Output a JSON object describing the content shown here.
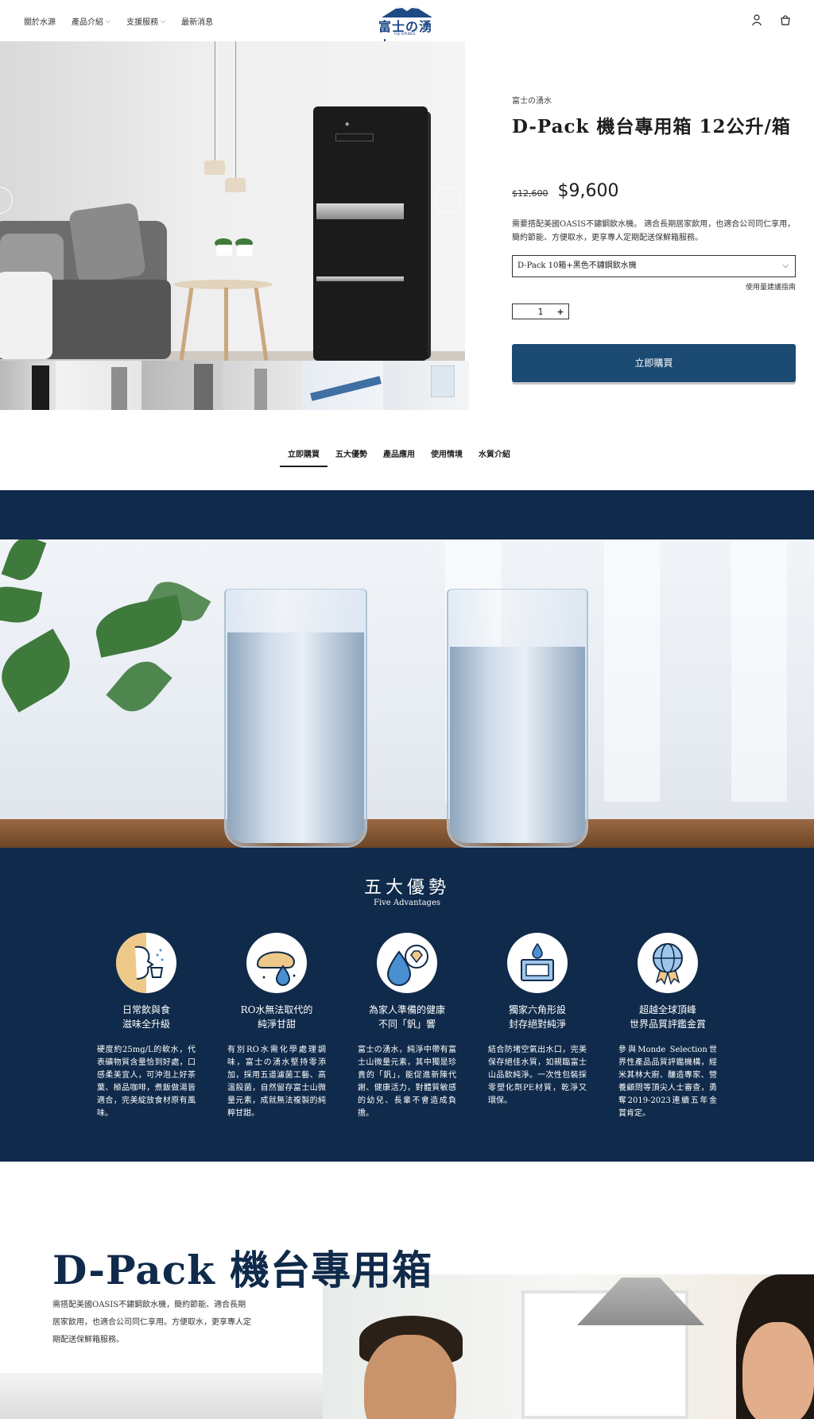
{
  "header": {
    "nav": [
      {
        "label": "關於水源",
        "has_dropdown": false
      },
      {
        "label": "產品介紹",
        "has_dropdown": true
      },
      {
        "label": "支援服務",
        "has_dropdown": true
      },
      {
        "label": "最新消息",
        "has_dropdown": false
      }
    ],
    "logo_text": "富士の湧水",
    "logo_sub": "FUJI SPRINGS",
    "icons": [
      "account-icon",
      "cart-icon"
    ]
  },
  "gallery": {
    "prev_arrow": "‹",
    "next_arrow": "›",
    "thumbnail_count": 6
  },
  "product": {
    "brand": "富士の湧水",
    "title": "D-Pack 機台專用箱 12公升/箱",
    "old_price": "$12,600",
    "price": "$9,600",
    "description": "需要搭配美國OASIS不鏽鋼飲水機。 適合長期居家飲用，也適合公司同仁享用，簡約節能、方便取水，更享專人定期配送保鮮箱服務。",
    "variant_selected": "D-Pack 10箱+黑色不鏽鋼飲水機",
    "guide_link": "使用量建議指南",
    "quantity": "1",
    "buy_label": "立即購買"
  },
  "tabs": [
    {
      "label": "立即購買",
      "active": true
    },
    {
      "label": "五大優勢",
      "active": false
    },
    {
      "label": "產品應用",
      "active": false
    },
    {
      "label": "使用情境",
      "active": false
    },
    {
      "label": "水質介紹",
      "active": false
    }
  ],
  "advantages": {
    "title": "五大優勢",
    "subtitle": "Five Advantages",
    "items": [
      {
        "icon": "drinking-face-icon",
        "heading_1": "日常飲與食",
        "heading_2": "滋味全升級",
        "text": "硬度約25mg/L的軟水，代表礦物質含量恰到好處，口感柔美宜人，可沖泡上好茶葉、極品咖啡，煮飯做湯皆適合，完美綻放食材原有風味。"
      },
      {
        "icon": "bread-drop-icon",
        "heading_1": "RO水無法取代的",
        "heading_2": "純淨甘甜",
        "text": "有別RO水需化學處理調味，富士の湧水堅持零添加，採用五道濾菌工藝、高溫殺菌，自然留存富士山微量元素，成就無法複製的純粹甘甜。"
      },
      {
        "icon": "mineral-drop-icon",
        "heading_1": "為家人準備的健康",
        "heading_2": "不同「釩」響",
        "text": "富士の湧水，純淨中帶有富士山微量元素，其中獨是珍貴的「釩」，能促進新陳代謝、健康活力，對體質敏感的幼兒、長輩不會造成負擔。"
      },
      {
        "icon": "hexagon-box-icon",
        "heading_1": "獨家六角形設",
        "heading_2": "封存絕對純淨",
        "text": "結合防堵空氣出水口，完美保存絕佳水質，如親臨富士山品飲純淨。一次性包裝採零塑化劑PE材質，乾淨又環保。"
      },
      {
        "icon": "globe-medal-icon",
        "heading_1": "超越全球頂峰",
        "heading_2": "世界品質評鑑金賞",
        "text": "參與Monde Selection世界性產品品質評鑑機構，經米其林大廚、釀造專家、營養顧問等頂尖人士審查，勇奪2019-2023連續五年金賞肯定。"
      }
    ]
  },
  "dpack": {
    "title": "D-Pack 機台專用箱",
    "description": "需搭配美國OASIS不鏽鋼飲水機，簡約節能、適合長期居家飲用，也適合公司同仁享用。方便取水，更享專人定期配送保鮮箱服務。"
  },
  "colors": {
    "navy": "#0f2a4a",
    "buy_button": "#1b4a73",
    "logo_blue": "#1e4a86"
  }
}
